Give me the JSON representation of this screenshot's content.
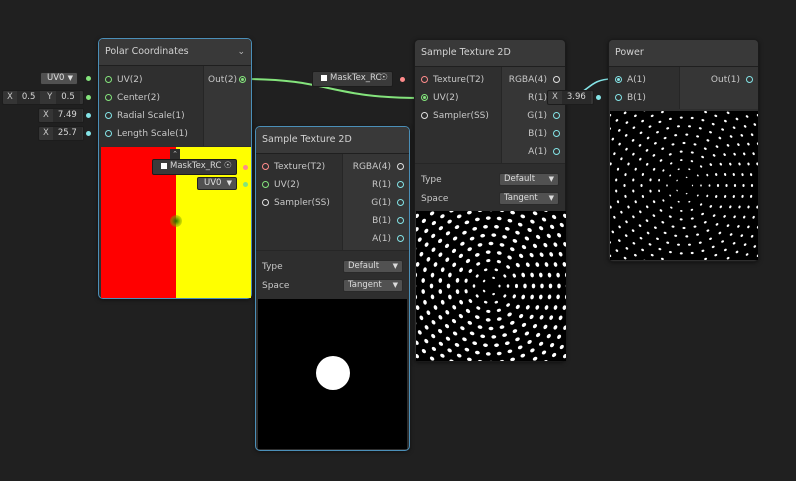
{
  "nodes": {
    "polar": {
      "title": "Polar Coordinates",
      "inputs": [
        "UV(2)",
        "Center(2)",
        "Radial Scale(1)",
        "Length Scale(1)"
      ],
      "outputs": [
        "Out(2)"
      ]
    },
    "sample1": {
      "title": "Sample Texture 2D",
      "inputs": [
        "Texture(T2)",
        "UV(2)",
        "Sampler(SS)"
      ],
      "outputs": [
        "RGBA(4)",
        "R(1)",
        "G(1)",
        "B(1)",
        "A(1)"
      ],
      "type_label": "Type",
      "type_value": "Default",
      "space_label": "Space",
      "space_value": "Tangent"
    },
    "sample2": {
      "title": "Sample Texture 2D",
      "inputs": [
        "Texture(T2)",
        "UV(2)",
        "Sampler(SS)"
      ],
      "outputs": [
        "RGBA(4)",
        "R(1)",
        "G(1)",
        "B(1)",
        "A(1)"
      ],
      "type_label": "Type",
      "type_value": "Default",
      "space_label": "Space",
      "space_value": "Tangent"
    },
    "power": {
      "title": "Power",
      "inputs": [
        "A(1)",
        "B(1)"
      ],
      "outputs": [
        "Out(1)"
      ]
    }
  },
  "fields": {
    "uv_polar": "UV0",
    "center_x_label": "X",
    "center_x": "0.5",
    "center_y_label": "Y",
    "center_y": "0.5",
    "radial_label": "X",
    "radial": "7.49",
    "length_label": "X",
    "length": "25.7",
    "mask_tex_1": "MaskTex_RC",
    "uv_sample2": "UV0",
    "mask_tex_2": "MaskTex_RC",
    "power_b_label": "X",
    "power_b": "3.96"
  },
  "colors": {
    "vector2": "#84e47c",
    "vector1": "#84e4e7",
    "texture": "#ff8b8b",
    "selection": "#4b8fb8"
  }
}
